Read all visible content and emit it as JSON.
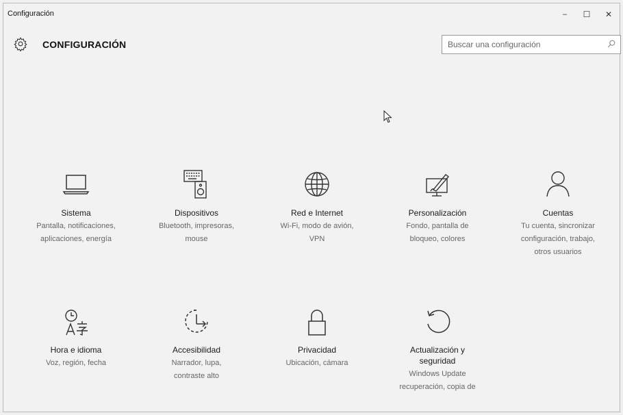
{
  "window": {
    "app_title": "Configuración",
    "controls": {
      "minimize": "–",
      "maximize": "☐",
      "close": "✕"
    }
  },
  "header": {
    "title": "CONFIGURACIÓN",
    "icon": "gear-icon"
  },
  "search": {
    "placeholder": "Buscar una configuración",
    "icon": "search-icon"
  },
  "tiles": [
    {
      "title": "Sistema",
      "desc_lines": [
        "Pantalla, notificaciones,",
        "aplicaciones, energía"
      ],
      "icon": "laptop-icon"
    },
    {
      "title": "Dispositivos",
      "desc_lines": [
        "Bluetooth, impresoras,",
        "mouse"
      ],
      "icon": "keyboard-speaker-icon"
    },
    {
      "title": "Red e Internet",
      "desc_lines": [
        "Wi-Fi, modo de avión,",
        "VPN"
      ],
      "icon": "globe-icon"
    },
    {
      "title": "Personalización",
      "desc_lines": [
        "Fondo, pantalla de",
        "bloqueo, colores"
      ],
      "icon": "monitor-brush-icon"
    },
    {
      "title": "Cuentas",
      "desc_lines": [
        "Tu cuenta, sincronizar",
        "configuración, trabajo,",
        "otros usuarios"
      ],
      "icon": "user-icon"
    },
    {
      "title": "Hora e idioma",
      "desc_lines": [
        "Voz, región, fecha"
      ],
      "icon": "time-language-icon"
    },
    {
      "title": "Accesibilidad",
      "desc_lines": [
        "Narrador, lupa,",
        "contraste alto"
      ],
      "icon": "accessibility-icon"
    },
    {
      "title": "Privacidad",
      "desc_lines": [
        "Ubicación, cámara"
      ],
      "icon": "lock-icon"
    },
    {
      "title": "Actualización y seguridad",
      "title_lines": [
        "Actualización y",
        "seguridad"
      ],
      "desc_lines": [
        "Windows Update",
        "recuperación, copia de"
      ],
      "icon": "refresh-icon"
    }
  ],
  "colors": {
    "background": "#f2f2f2",
    "text": "#1a1a1a",
    "secondary_text": "#666666",
    "icon_stroke": "#333333"
  }
}
